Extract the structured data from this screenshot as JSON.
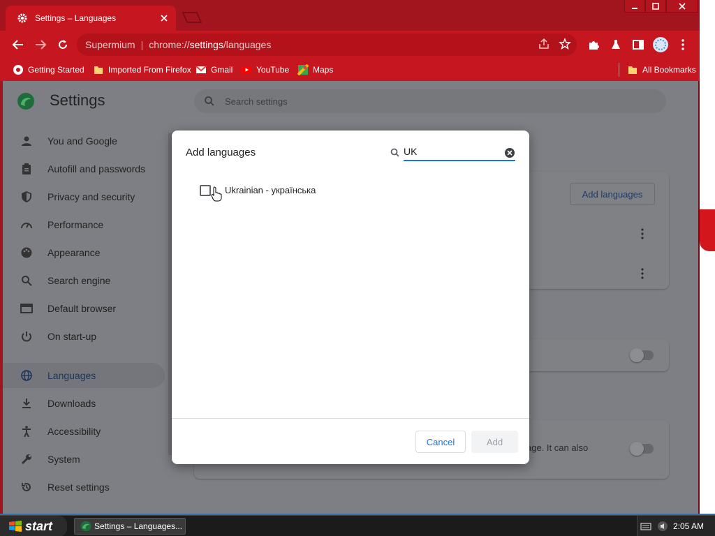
{
  "window": {
    "tab_title": "Settings – Languages",
    "controls": [
      "minimize",
      "maximize",
      "close"
    ]
  },
  "toolbar": {
    "omnibox_site": "Supermium",
    "omnibox_url_prefix": "chrome://",
    "omnibox_url_highlight": "settings",
    "omnibox_url_suffix": "/languages"
  },
  "bookmarks": {
    "items": [
      {
        "label": "Getting Started",
        "icon": "globe-icon"
      },
      {
        "label": "Imported From Firefox",
        "icon": "folder-icon"
      },
      {
        "label": "Gmail",
        "icon": "gmail-icon"
      },
      {
        "label": "YouTube",
        "icon": "youtube-icon"
      },
      {
        "label": "Maps",
        "icon": "maps-icon"
      }
    ],
    "all_bookmarks": "All Bookmarks"
  },
  "settings": {
    "title": "Settings",
    "search_placeholder": "Search settings",
    "nav": [
      {
        "label": "You and Google",
        "icon": "person-icon"
      },
      {
        "label": "Autofill and passwords",
        "icon": "clipboard-icon"
      },
      {
        "label": "Privacy and security",
        "icon": "shield-icon"
      },
      {
        "label": "Performance",
        "icon": "speedometer-icon"
      },
      {
        "label": "Appearance",
        "icon": "palette-icon"
      },
      {
        "label": "Search engine",
        "icon": "search-icon"
      },
      {
        "label": "Default browser",
        "icon": "browser-icon"
      },
      {
        "label": "On start-up",
        "icon": "power-icon"
      },
      {
        "label": "Languages",
        "icon": "globe-icon",
        "active": true
      },
      {
        "label": "Downloads",
        "icon": "download-icon"
      },
      {
        "label": "Accessibility",
        "icon": "accessibility-icon"
      },
      {
        "label": "System",
        "icon": "wrench-icon"
      },
      {
        "label": "Reset settings",
        "icon": "reset-icon"
      }
    ],
    "add_languages_button": "Add languages",
    "partial_text": "age. It can also"
  },
  "dialog": {
    "title": "Add languages",
    "search_value": "UK",
    "results": [
      {
        "label": "Ukrainian - українська",
        "checked": false
      }
    ],
    "cancel_label": "Cancel",
    "add_label": "Add"
  },
  "taskbar": {
    "start_label": "start",
    "task_label": "Settings – Languages...",
    "clock": "2:05 AM"
  },
  "colors": {
    "browser_frame": "#a3151e",
    "toolbar": "#c6161f",
    "accent_blue": "#1a73e8",
    "scrim": "#7d7f84"
  }
}
